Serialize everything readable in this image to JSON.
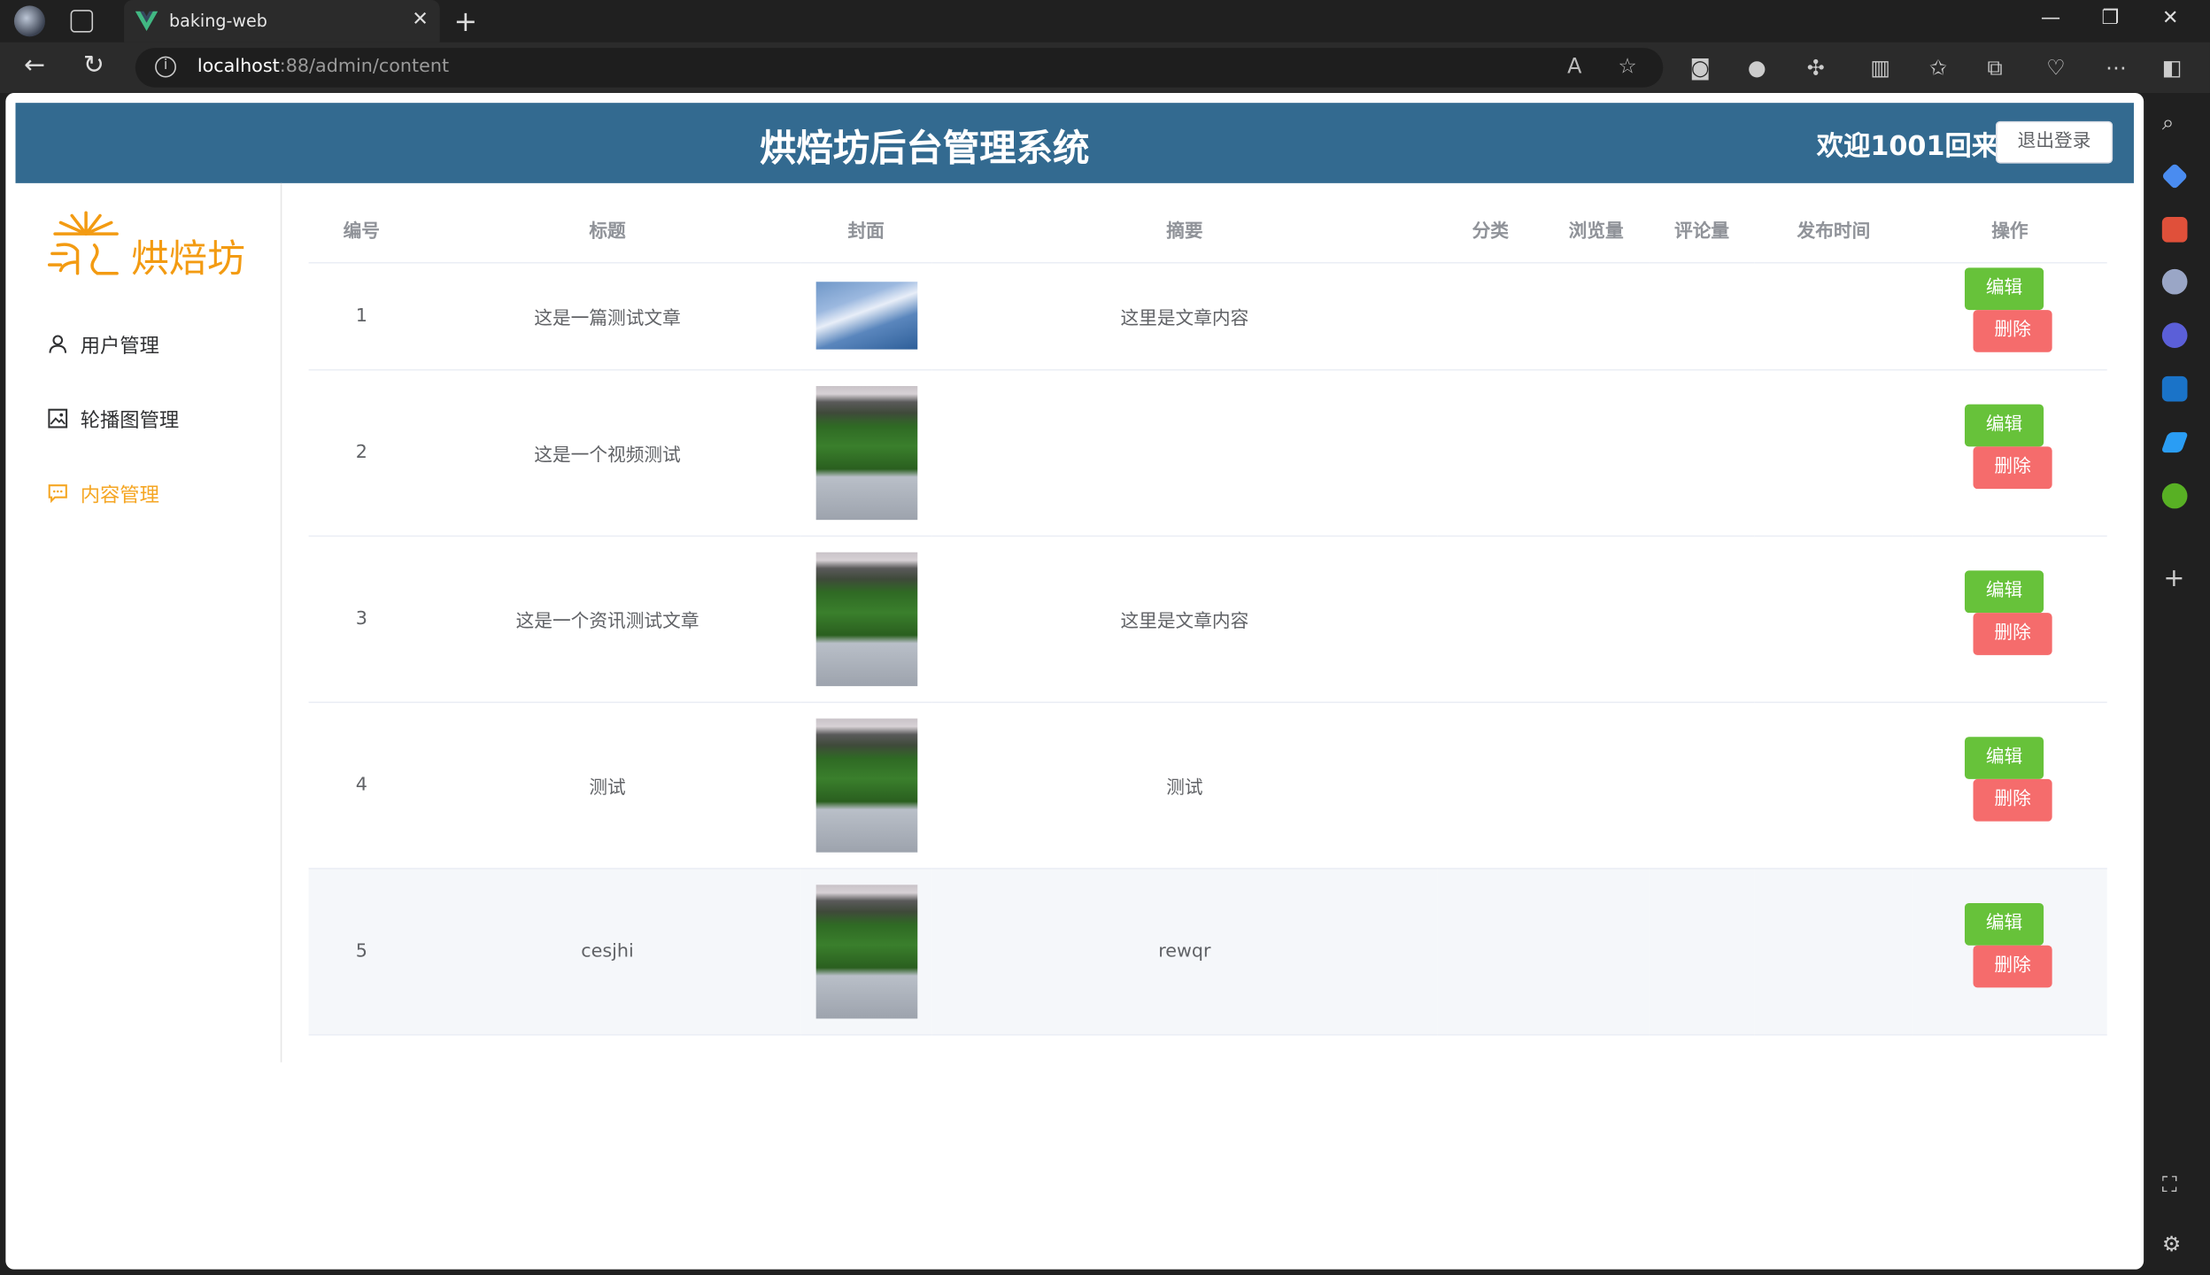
{
  "browser": {
    "tab_title": "baking-web",
    "url_host": "localhost",
    "url_path": ":88/admin/content"
  },
  "header": {
    "title": "烘焙坊后台管理系统",
    "welcome": "欢迎1001回来!",
    "logout_label": "退出登录"
  },
  "sidebar": {
    "logo_text": "烘焙坊",
    "items": [
      {
        "label": "用户管理",
        "icon": "user-icon"
      },
      {
        "label": "轮播图管理",
        "icon": "picture-icon"
      },
      {
        "label": "内容管理",
        "icon": "chat-icon",
        "active": true
      }
    ]
  },
  "table": {
    "columns": [
      "编号",
      "标题",
      "封面",
      "摘要",
      "分类",
      "浏览量",
      "评论量",
      "发布时间",
      "操作"
    ],
    "edit_label": "编辑",
    "delete_label": "删除",
    "rows": [
      {
        "id": "1",
        "title": "这是一篇测试文章",
        "cover": "sky",
        "summary": "这里是文章内容",
        "category": "",
        "views": "",
        "comments": "",
        "published": ""
      },
      {
        "id": "2",
        "title": "这是一个视频测试",
        "cover": "tree",
        "summary": "",
        "category": "",
        "views": "",
        "comments": "",
        "published": ""
      },
      {
        "id": "3",
        "title": "这是一个资讯测试文章",
        "cover": "tree",
        "summary": "这里是文章内容",
        "category": "",
        "views": "",
        "comments": "",
        "published": ""
      },
      {
        "id": "4",
        "title": "测试",
        "cover": "tree",
        "summary": "测试",
        "category": "",
        "views": "",
        "comments": "",
        "published": ""
      },
      {
        "id": "5",
        "title": "cesjhi",
        "cover": "tree",
        "summary": "rewqr",
        "category": "",
        "views": "",
        "comments": "",
        "published": ""
      }
    ]
  },
  "colors": {
    "header_bg": "#336a90",
    "accent": "#f5a623",
    "edit_button": "#67c23a",
    "delete_button": "#f56c6c"
  }
}
